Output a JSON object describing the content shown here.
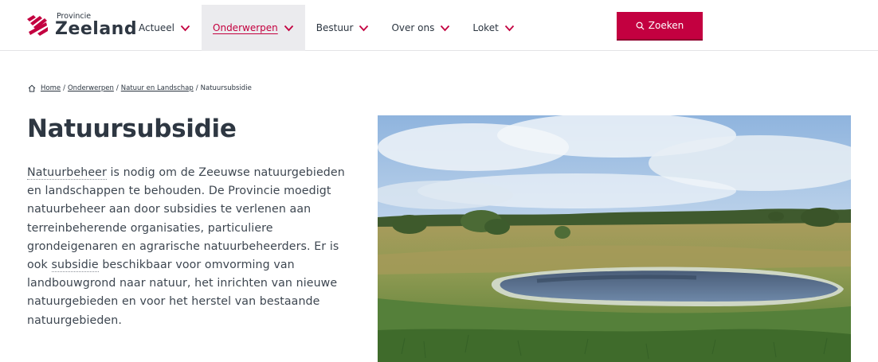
{
  "brand": {
    "small": "Provincie",
    "big": "Zeeland",
    "color": "#c30040"
  },
  "nav": {
    "items": [
      {
        "label": "Actueel",
        "active": false
      },
      {
        "label": "Onderwerpen",
        "active": true
      },
      {
        "label": "Bestuur",
        "active": false
      },
      {
        "label": "Over ons",
        "active": false
      },
      {
        "label": "Loket",
        "active": false
      }
    ],
    "search_label": "Zoeken"
  },
  "breadcrumb": {
    "items": [
      {
        "label": "Home",
        "link": true
      },
      {
        "label": "Onderwerpen",
        "link": true
      },
      {
        "label": "Natuur en Landschap",
        "link": true
      },
      {
        "label": "Natuursubsidie",
        "link": false
      }
    ],
    "separator": "/"
  },
  "page": {
    "title": "Natuursubsidie",
    "intro_parts": [
      "Natuurbeheer",
      " is nodig om de Zeeuwse natuurgebieden en landschappen te behouden. De Provincie moedigt natuurbeheer aan door subsidies te verlenen aan terreinbeherende organisaties, particuliere grondeigenaren en agrarische natuurbeheerders. Er is ook ",
      "subsidie",
      " beschikbaar voor omvorming van landbouwgrond naar natuur, het inrichten van nieuwe natuurgebieden en voor het herstel van bestaande natuurgebieden."
    ]
  },
  "hero_image": {
    "subject": "dune landscape with pond"
  },
  "icons": {
    "home": "home-icon",
    "search": "search-icon",
    "chevron": "chevron-down-icon",
    "logo": "logo-mark-icon"
  }
}
